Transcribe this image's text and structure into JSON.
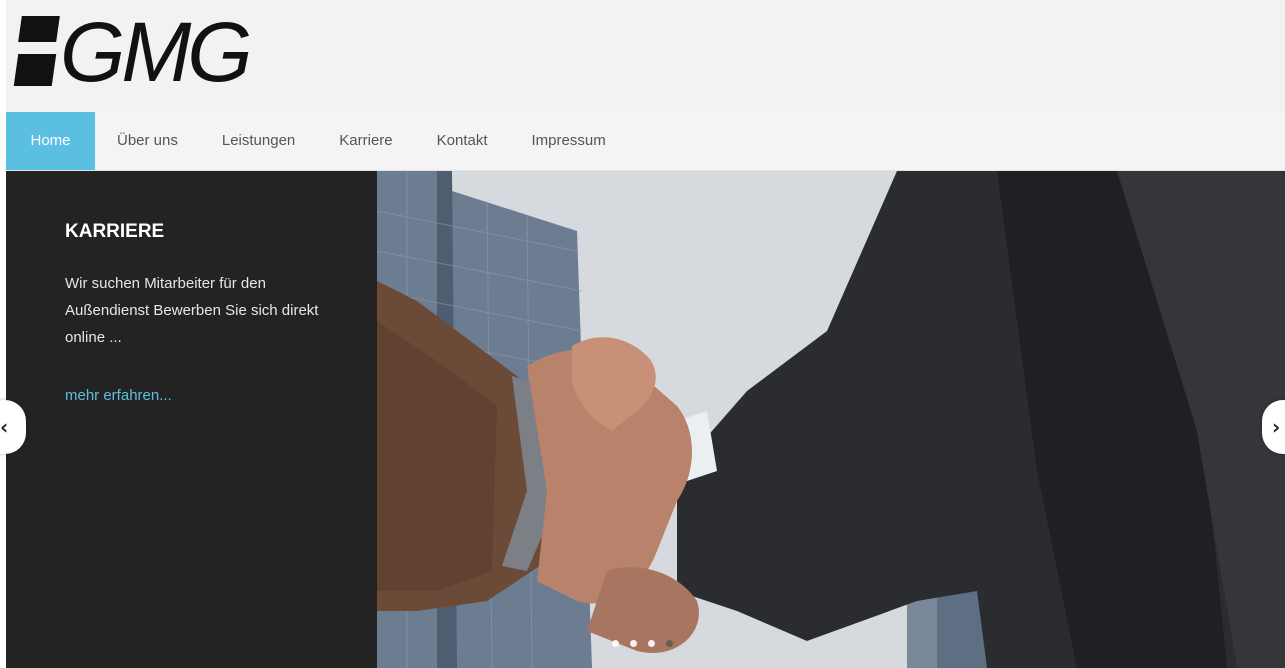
{
  "brand": {
    "logo_text": "GMG"
  },
  "nav": {
    "items": [
      {
        "label": "Home",
        "active": true
      },
      {
        "label": "Über uns",
        "active": false
      },
      {
        "label": "Leistungen",
        "active": false
      },
      {
        "label": "Karriere",
        "active": false
      },
      {
        "label": "Kontakt",
        "active": false
      },
      {
        "label": "Impressum",
        "active": false
      }
    ]
  },
  "slider": {
    "title": "KARRIERE",
    "text": "Wir suchen Mitarbeiter für den Außendienst Bewerben Sie sich direkt online ...",
    "link": "mehr erfahren...",
    "prev_icon": "chevron-left-icon",
    "next_icon": "chevron-right-icon",
    "slide_count": 4,
    "active_slide": 1
  },
  "colors": {
    "accent": "#5bbfe1",
    "panel_bg": "#232323",
    "header_bg": "#f2f2f2"
  }
}
